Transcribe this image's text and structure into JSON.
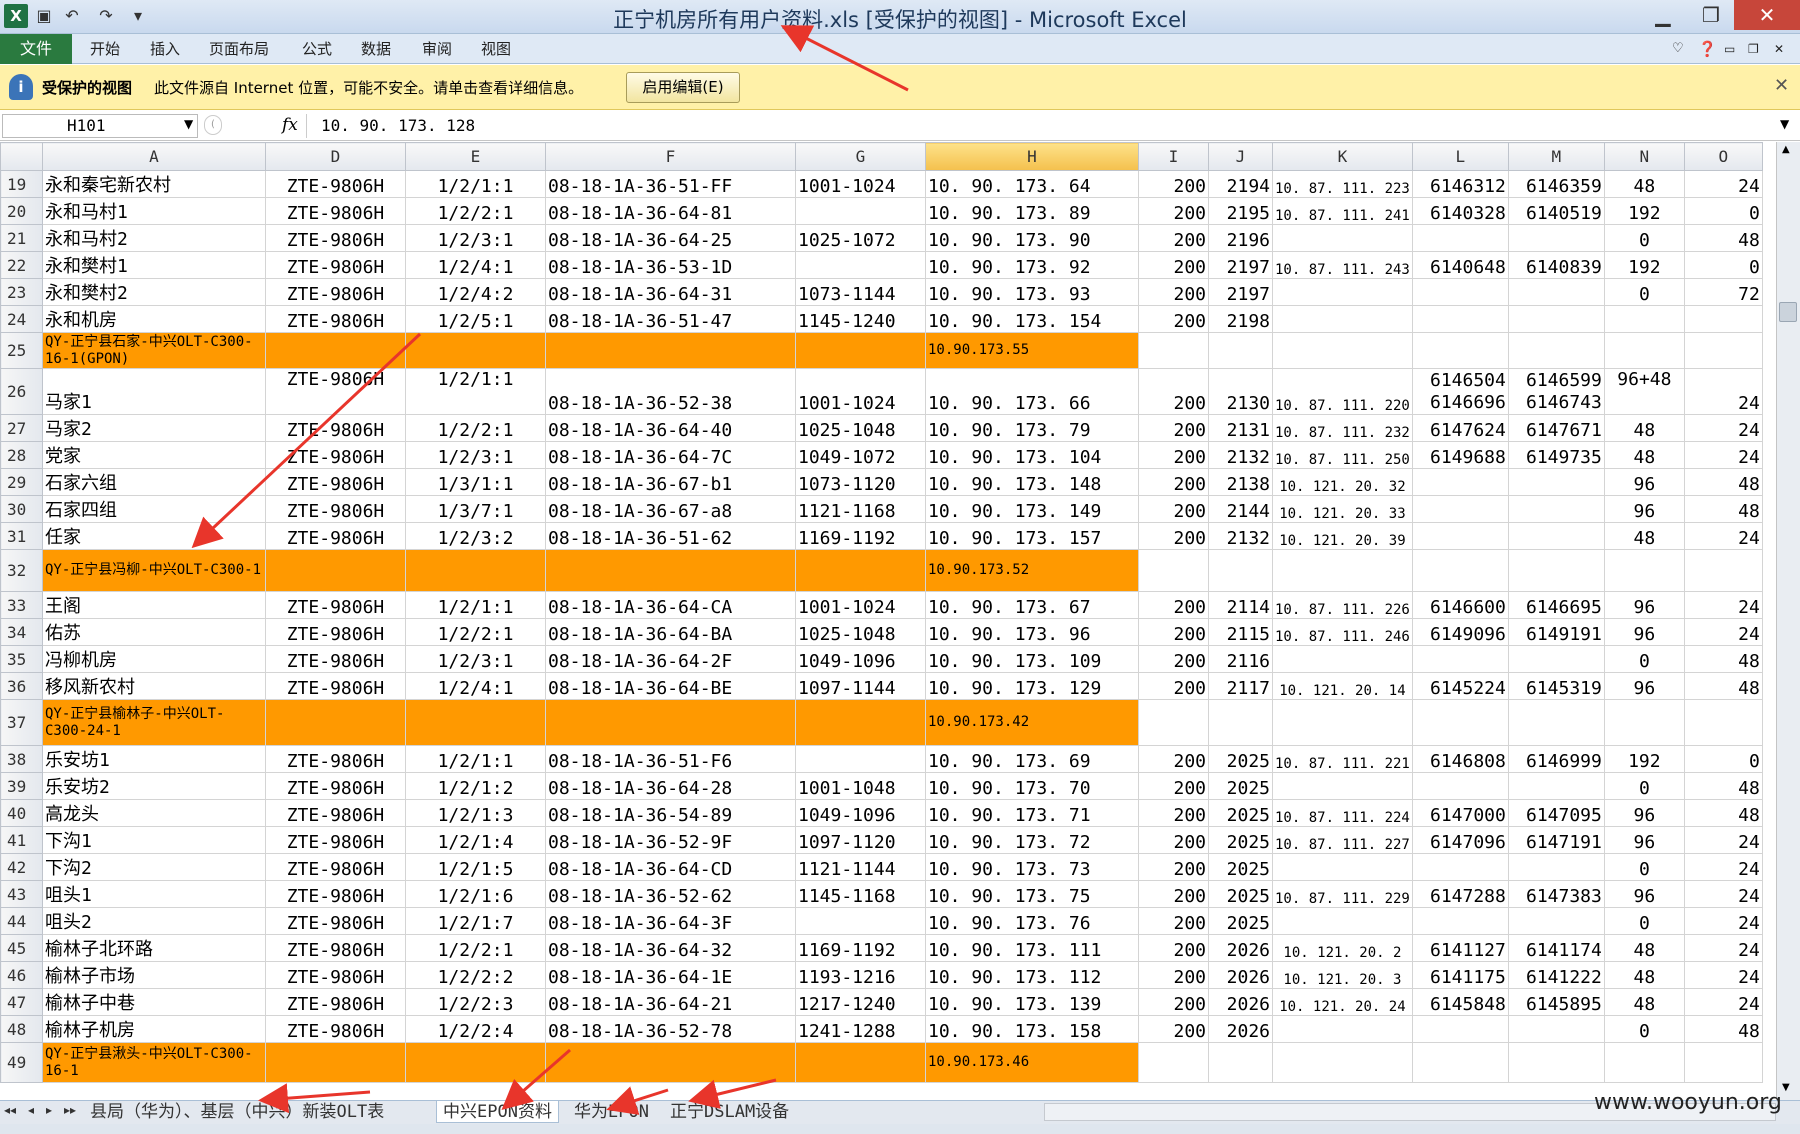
{
  "window": {
    "title": "正宁机房所有用户资料.xls  [受保护的视图]  -  Microsoft Excel",
    "app_icon": "X",
    "min": "▁",
    "max": "❐",
    "close": "✕"
  },
  "ribbon": {
    "file": "文件",
    "tabs": [
      "开始",
      "插入",
      "页面布局",
      "公式",
      "数据",
      "审阅",
      "视图"
    ]
  },
  "protected_bar": {
    "title": "受保护的视图",
    "message": "此文件源自 Internet 位置，可能不安全。请单击查看详细信息。",
    "enable_button": "启用编辑(E)"
  },
  "formula_bar": {
    "name_box": "H101",
    "fx": "fx",
    "value": "10. 90. 173. 128"
  },
  "columns": [
    "A",
    "D",
    "E",
    "F",
    "G",
    "H",
    "I",
    "J",
    "K",
    "L",
    "M",
    "N",
    "O"
  ],
  "selected_column": "H",
  "rows": [
    {
      "n": "19",
      "cells": [
        "永和秦宅新农村",
        "ZTE-9806H",
        "1/2/1:1",
        "08-18-1A-36-51-FF",
        "1001-1024",
        "10. 90. 173. 64",
        "200",
        "2194",
        "10. 87. 111. 223",
        "6146312",
        "6146359",
        "48",
        "24"
      ]
    },
    {
      "n": "20",
      "cells": [
        "永和马村1",
        "ZTE-9806H",
        "1/2/2:1",
        "08-18-1A-36-64-81",
        "",
        "10. 90. 173. 89",
        "200",
        "2195",
        "10. 87. 111. 241",
        "6140328",
        "6140519",
        "192",
        "0"
      ]
    },
    {
      "n": "21",
      "cells": [
        "永和马村2",
        "ZTE-9806H",
        "1/2/3:1",
        "08-18-1A-36-64-25",
        "1025-1072",
        "10. 90. 173. 90",
        "200",
        "2196",
        "",
        "",
        "",
        "0",
        "48"
      ]
    },
    {
      "n": "22",
      "cells": [
        "永和樊村1",
        "ZTE-9806H",
        "1/2/4:1",
        "08-18-1A-36-53-1D",
        "",
        "10. 90. 173. 92",
        "200",
        "2197",
        "10. 87. 111. 243",
        "6140648",
        "6140839",
        "192",
        "0"
      ]
    },
    {
      "n": "23",
      "cells": [
        "永和樊村2",
        "ZTE-9806H",
        "1/2/4:2",
        "08-18-1A-36-64-31",
        "1073-1144",
        "10. 90. 173. 93",
        "200",
        "2197",
        "",
        "",
        "",
        "0",
        "72"
      ]
    },
    {
      "n": "24",
      "cells": [
        "永和机房",
        "ZTE-9806H",
        "1/2/5:1",
        "08-18-1A-36-51-47",
        "1145-1240",
        "10. 90. 173. 154",
        "200",
        "2198",
        "",
        "",
        "",
        "",
        ""
      ]
    },
    {
      "n": "25",
      "header": true,
      "a": "QY-正宁县石家-中兴OLT-C300-16-1(GPON)",
      "h": "10.90.173.55"
    },
    {
      "n": "26",
      "tall": true,
      "cells": [
        "马家1",
        "ZTE-9806H",
        "1/2/1:1",
        "08-18-1A-36-52-38",
        "1001-1024",
        "10. 90. 173. 66",
        "200",
        "2130",
        "10. 87. 111. 220",
        "6146504 6146696",
        "6146599 6146743",
        "96+48",
        "24"
      ]
    },
    {
      "n": "27",
      "cells": [
        "马家2",
        "ZTE-9806H",
        "1/2/2:1",
        "08-18-1A-36-64-40",
        "1025-1048",
        "10. 90. 173. 79",
        "200",
        "2131",
        "10. 87. 111. 232",
        "6147624",
        "6147671",
        "48",
        "24"
      ]
    },
    {
      "n": "28",
      "cells": [
        "党家",
        "ZTE-9806H",
        "1/2/3:1",
        "08-18-1A-36-64-7C",
        "1049-1072",
        "10. 90. 173. 104",
        "200",
        "2132",
        "10. 87. 111. 250",
        "6149688",
        "6149735",
        "48",
        "24"
      ]
    },
    {
      "n": "29",
      "cells": [
        "石家六组",
        "ZTE-9806H",
        "1/3/1:1",
        "08-18-1A-36-67-b1",
        "1073-1120",
        "10. 90. 173. 148",
        "200",
        "2138",
        "10. 121. 20. 32",
        "",
        "",
        "96",
        "48"
      ]
    },
    {
      "n": "30",
      "cells": [
        "石家四组",
        "ZTE-9806H",
        "1/3/7:1",
        "08-18-1A-36-67-a8",
        "1121-1168",
        "10. 90. 173. 149",
        "200",
        "2144",
        "10. 121. 20. 33",
        "",
        "",
        "96",
        "48"
      ]
    },
    {
      "n": "31",
      "cells": [
        "任家",
        "ZTE-9806H",
        "1/2/3:2",
        "08-18-1A-36-51-62",
        "1169-1192",
        "10. 90. 173. 157",
        "200",
        "2132",
        "10. 121. 20. 39",
        "",
        "",
        "48",
        "24"
      ]
    },
    {
      "n": "32",
      "header": true,
      "a": "QY-正宁县冯柳-中兴OLT-C300-1",
      "h": "10.90.173.52"
    },
    {
      "n": "33",
      "cells": [
        "王阁",
        "ZTE-9806H",
        "1/2/1:1",
        "08-18-1A-36-64-CA",
        "1001-1024",
        "10. 90. 173. 67",
        "200",
        "2114",
        "10. 87. 111. 226",
        "6146600",
        "6146695",
        "96",
        "24"
      ]
    },
    {
      "n": "34",
      "cells": [
        "佑苏",
        "ZTE-9806H",
        "1/2/2:1",
        "08-18-1A-36-64-BA",
        "1025-1048",
        "10. 90. 173. 96",
        "200",
        "2115",
        "10. 87. 111. 246",
        "6149096",
        "6149191",
        "96",
        "24"
      ]
    },
    {
      "n": "35",
      "cells": [
        "冯柳机房",
        "ZTE-9806H",
        "1/2/3:1",
        "08-18-1A-36-64-2F",
        "1049-1096",
        "10. 90. 173. 109",
        "200",
        "2116",
        "",
        "",
        "",
        "0",
        "48"
      ]
    },
    {
      "n": "36",
      "cells": [
        "移风新农村",
        "ZTE-9806H",
        "1/2/4:1",
        "08-18-1A-36-64-BE",
        "1097-1144",
        "10. 90. 173. 129",
        "200",
        "2117",
        "10. 121. 20. 14",
        "6145224",
        "6145319",
        "96",
        "48"
      ]
    },
    {
      "n": "37",
      "header": true,
      "a": "QY-正宁县榆林子-中兴OLT-C300-24-1",
      "h": "10.90.173.42"
    },
    {
      "n": "38",
      "cells": [
        "乐安坊1",
        "ZTE-9806H",
        "1/2/1:1",
        "08-18-1A-36-51-F6",
        "",
        "10. 90. 173. 69",
        "200",
        "2025",
        "10. 87. 111. 221",
        "6146808",
        "6146999",
        "192",
        "0"
      ]
    },
    {
      "n": "39",
      "cells": [
        "乐安坊2",
        "ZTE-9806H",
        "1/2/1:2",
        "08-18-1A-36-64-28",
        "1001-1048",
        "10. 90. 173. 70",
        "200",
        "2025",
        "",
        "",
        "",
        "0",
        "48"
      ]
    },
    {
      "n": "40",
      "cells": [
        "高龙头",
        "ZTE-9806H",
        "1/2/1:3",
        "08-18-1A-36-54-89",
        "1049-1096",
        "10. 90. 173. 71",
        "200",
        "2025",
        "10. 87. 111. 224",
        "6147000",
        "6147095",
        "96",
        "48"
      ]
    },
    {
      "n": "41",
      "cells": [
        "下沟1",
        "ZTE-9806H",
        "1/2/1:4",
        "08-18-1A-36-52-9F",
        "1097-1120",
        "10. 90. 173. 72",
        "200",
        "2025",
        "10. 87. 111. 227",
        "6147096",
        "6147191",
        "96",
        "24"
      ]
    },
    {
      "n": "42",
      "cells": [
        "下沟2",
        "ZTE-9806H",
        "1/2/1:5",
        "08-18-1A-36-64-CD",
        "1121-1144",
        "10. 90. 173. 73",
        "200",
        "2025",
        "",
        "",
        "",
        "0",
        "24"
      ]
    },
    {
      "n": "43",
      "cells": [
        "咀头1",
        "ZTE-9806H",
        "1/2/1:6",
        "08-18-1A-36-52-62",
        "1145-1168",
        "10. 90. 173. 75",
        "200",
        "2025",
        "10. 87. 111. 229",
        "6147288",
        "6147383",
        "96",
        "24"
      ]
    },
    {
      "n": "44",
      "cells": [
        "咀头2",
        "ZTE-9806H",
        "1/2/1:7",
        "08-18-1A-36-64-3F",
        "",
        "10. 90. 173. 76",
        "200",
        "2025",
        "",
        "",
        "",
        "0",
        "24"
      ]
    },
    {
      "n": "45",
      "cells": [
        "榆林子北环路",
        "ZTE-9806H",
        "1/2/2:1",
        "08-18-1A-36-64-32",
        "1169-1192",
        "10. 90. 173. 111",
        "200",
        "2026",
        "10. 121. 20. 2",
        "6141127",
        "6141174",
        "48",
        "24"
      ]
    },
    {
      "n": "46",
      "cells": [
        "榆林子市场",
        "ZTE-9806H",
        "1/2/2:2",
        "08-18-1A-36-64-1E",
        "1193-1216",
        "10. 90. 173. 112",
        "200",
        "2026",
        "10. 121. 20. 3",
        "6141175",
        "6141222",
        "48",
        "24"
      ]
    },
    {
      "n": "47",
      "cells": [
        "榆林子中巷",
        "ZTE-9806H",
        "1/2/2:3",
        "08-18-1A-36-64-21",
        "1217-1240",
        "10. 90. 173. 139",
        "200",
        "2026",
        "10. 121. 20. 24",
        "6145848",
        "6145895",
        "48",
        "24"
      ]
    },
    {
      "n": "48",
      "cells": [
        "榆林子机房",
        "ZTE-9806H",
        "1/2/2:4",
        "08-18-1A-36-52-78",
        "1241-1288",
        "10. 90. 173. 158",
        "200",
        "2026",
        "",
        "",
        "",
        "0",
        "48"
      ]
    },
    {
      "n": "49",
      "header": true,
      "a": "QY-正宁县湫头-中兴OLT-C300-16-1",
      "h": "10.90.173.46"
    }
  ],
  "sheet_tabs": [
    "县局（华为）、基层（中兴）新装OLT表",
    "中兴EPON资料",
    "华为EPON",
    "正宁DSLAM设备"
  ],
  "sheet_nav": [
    "◂◂",
    "◂",
    "▸",
    "▸▸"
  ],
  "watermark": "www.wooyun.org",
  "colors": {
    "orange_header": "#ff9900",
    "selected_col": "#f4c04d",
    "protected_bar": "#fff1a8",
    "arrow": "#e8352b"
  }
}
